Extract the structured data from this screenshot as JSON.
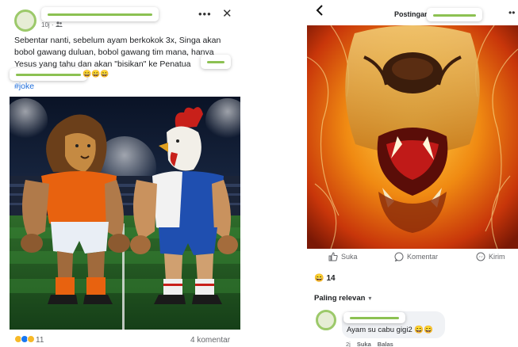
{
  "left_post": {
    "meta_time": "10j ·",
    "post_text": "Sebentar nanti, sebelum ayam berkokok 3x, Singa akan\nbobol gawang duluan, bobol gawang tim mana, hanya\nYesus yang tahu dan akan \"bisikan\" ke Penatua",
    "emoji_tail": "😄😄😄",
    "hashtag": "#joke",
    "reaction_count": "11",
    "comment_count": "4 komentar",
    "image_description_icon": "lion-vs-rooster-football-image"
  },
  "right_post": {
    "title": "Postingan",
    "actions": {
      "like": "Suka",
      "comment": "Komentar",
      "share": "Kirim"
    },
    "reaction_count": "14",
    "sort_label": "Paling relevan",
    "comment": {
      "text": "Ayam su cabu gigi2 😄😄",
      "time": "2j",
      "like": "Suka",
      "reply": "Balas"
    }
  },
  "colors": {
    "link_blue": "#216fdb",
    "redaction_green": "#8cc152",
    "secondary_text": "#65676b"
  }
}
